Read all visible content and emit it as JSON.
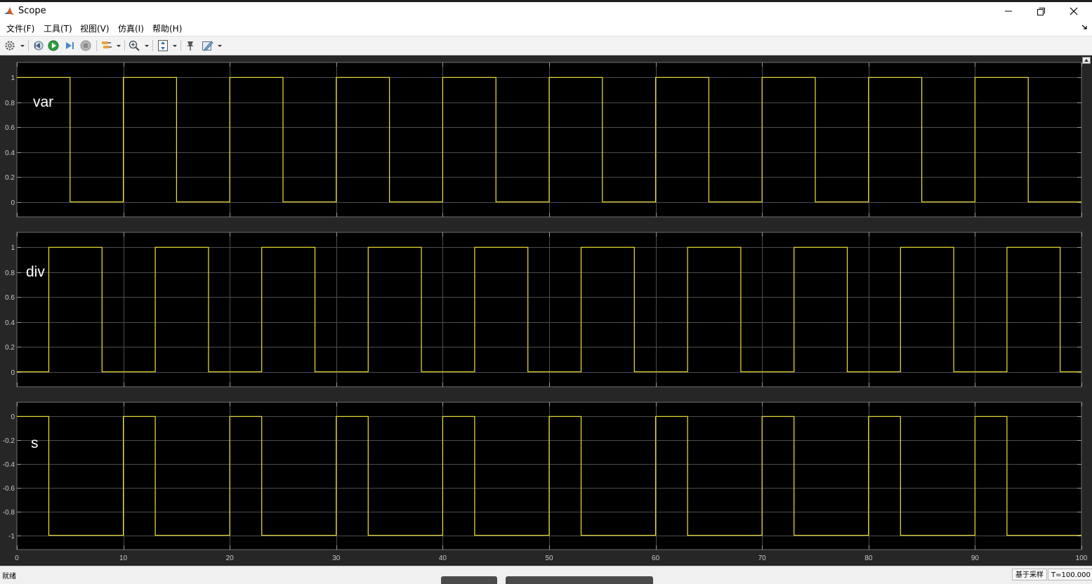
{
  "window": {
    "title": "Scope"
  },
  "menu": [
    "文件(F)",
    "工具(T)",
    "视图(V)",
    "仿真(I)",
    "帮助(H)"
  ],
  "toolbar_icons": [
    "settings-icon",
    "step-back-icon",
    "run-icon",
    "step-forward-icon",
    "stop-icon",
    "highlight-icon",
    "zoom-icon",
    "scale-axes-icon",
    "pin-icon",
    "edit-style-icon"
  ],
  "colors": {
    "signal": "#f0e432",
    "axes_bg": "#000000",
    "figure_bg": "#262626",
    "grid": "#4d4d4d",
    "tick_text": "#c8c8c8",
    "label_text": "#ffffff"
  },
  "chart_data": [
    {
      "type": "line",
      "step": true,
      "label": "var",
      "xlim": [
        0,
        100
      ],
      "ylim": [
        -0.12,
        1.12
      ],
      "yticks": [
        "1",
        "0.8",
        "0.6",
        "0.4",
        "0.2",
        "0"
      ],
      "yticks_values": [
        1,
        0.8,
        0.6,
        0.4,
        0.2,
        0
      ],
      "x": [
        0,
        5,
        10,
        15,
        20,
        25,
        30,
        35,
        40,
        45,
        50,
        55,
        60,
        65,
        70,
        75,
        80,
        85,
        90,
        95,
        100
      ],
      "y": [
        1,
        0,
        1,
        0,
        1,
        0,
        1,
        0,
        1,
        0,
        1,
        0,
        1,
        0,
        1,
        0,
        1,
        0,
        1,
        0,
        0
      ],
      "grid": true
    },
    {
      "type": "line",
      "step": true,
      "label": "div",
      "xlim": [
        0,
        100
      ],
      "ylim": [
        -0.12,
        1.12
      ],
      "yticks": [
        "1",
        "0.8",
        "0.6",
        "0.4",
        "0.2",
        "0"
      ],
      "yticks_values": [
        1,
        0.8,
        0.6,
        0.4,
        0.2,
        0
      ],
      "x": [
        0,
        3,
        8,
        13,
        18,
        23,
        28,
        33,
        38,
        43,
        48,
        53,
        58,
        63,
        68,
        73,
        78,
        83,
        88,
        93,
        98,
        100
      ],
      "y": [
        0,
        1,
        0,
        1,
        0,
        1,
        0,
        1,
        0,
        1,
        0,
        1,
        0,
        1,
        0,
        1,
        0,
        1,
        0,
        1,
        0,
        0
      ],
      "grid": true
    },
    {
      "type": "line",
      "step": true,
      "label": "s",
      "xlim": [
        0,
        100
      ],
      "ylim": [
        -1.12,
        0.12
      ],
      "yticks": [
        "0",
        "-0.2",
        "-0.4",
        "-0.6",
        "-0.8",
        "-1"
      ],
      "yticks_values": [
        0,
        -0.2,
        -0.4,
        -0.6,
        -0.8,
        -1
      ],
      "xticks": [
        "0",
        "10",
        "20",
        "30",
        "40",
        "50",
        "60",
        "70",
        "80",
        "90",
        "100"
      ],
      "xticks_values": [
        0,
        10,
        20,
        30,
        40,
        50,
        60,
        70,
        80,
        90,
        100
      ],
      "x": [
        0,
        3,
        10,
        13,
        20,
        23,
        30,
        33,
        40,
        43,
        50,
        53,
        60,
        63,
        70,
        73,
        80,
        83,
        90,
        93,
        100
      ],
      "y": [
        0,
        -1,
        0,
        -1,
        0,
        -1,
        0,
        -1,
        0,
        -1,
        0,
        -1,
        0,
        -1,
        0,
        -1,
        0,
        -1,
        0,
        -1,
        -1
      ],
      "grid": true
    }
  ],
  "status": {
    "left": "就绪",
    "mode": "基于采样",
    "time": "T=100.000"
  }
}
